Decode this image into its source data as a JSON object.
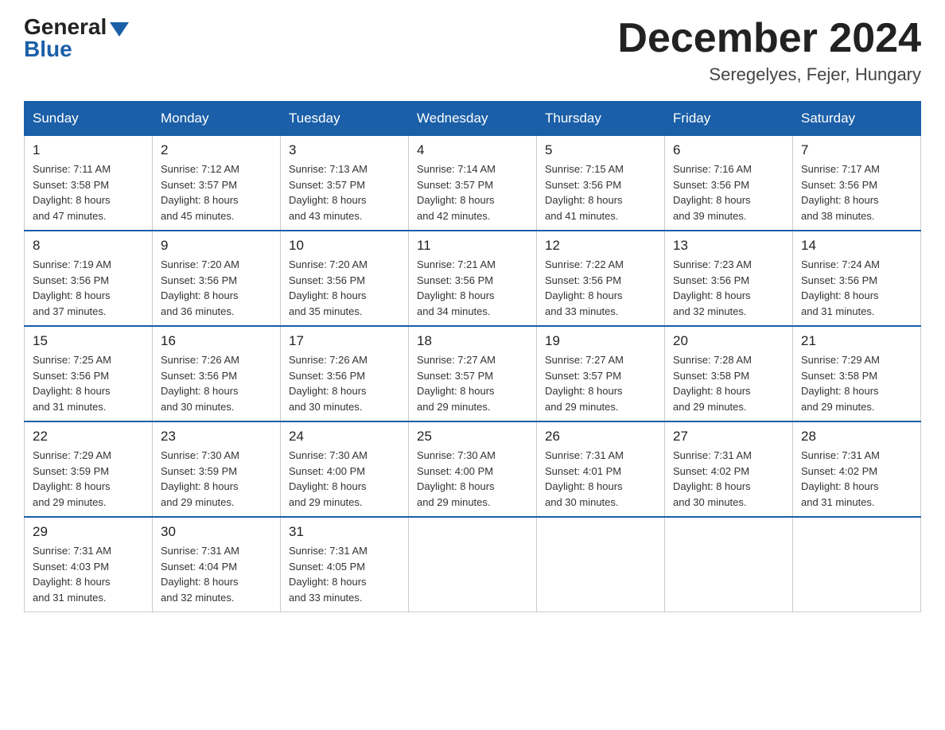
{
  "header": {
    "logo_general": "General",
    "logo_blue": "Blue",
    "month_title": "December 2024",
    "location": "Seregelyes, Fejer, Hungary"
  },
  "days_of_week": [
    "Sunday",
    "Monday",
    "Tuesday",
    "Wednesday",
    "Thursday",
    "Friday",
    "Saturday"
  ],
  "weeks": [
    [
      {
        "day": "1",
        "sunrise": "7:11 AM",
        "sunset": "3:58 PM",
        "daylight": "8 hours and 47 minutes."
      },
      {
        "day": "2",
        "sunrise": "7:12 AM",
        "sunset": "3:57 PM",
        "daylight": "8 hours and 45 minutes."
      },
      {
        "day": "3",
        "sunrise": "7:13 AM",
        "sunset": "3:57 PM",
        "daylight": "8 hours and 43 minutes."
      },
      {
        "day": "4",
        "sunrise": "7:14 AM",
        "sunset": "3:57 PM",
        "daylight": "8 hours and 42 minutes."
      },
      {
        "day": "5",
        "sunrise": "7:15 AM",
        "sunset": "3:56 PM",
        "daylight": "8 hours and 41 minutes."
      },
      {
        "day": "6",
        "sunrise": "7:16 AM",
        "sunset": "3:56 PM",
        "daylight": "8 hours and 39 minutes."
      },
      {
        "day": "7",
        "sunrise": "7:17 AM",
        "sunset": "3:56 PM",
        "daylight": "8 hours and 38 minutes."
      }
    ],
    [
      {
        "day": "8",
        "sunrise": "7:19 AM",
        "sunset": "3:56 PM",
        "daylight": "8 hours and 37 minutes."
      },
      {
        "day": "9",
        "sunrise": "7:20 AM",
        "sunset": "3:56 PM",
        "daylight": "8 hours and 36 minutes."
      },
      {
        "day": "10",
        "sunrise": "7:20 AM",
        "sunset": "3:56 PM",
        "daylight": "8 hours and 35 minutes."
      },
      {
        "day": "11",
        "sunrise": "7:21 AM",
        "sunset": "3:56 PM",
        "daylight": "8 hours and 34 minutes."
      },
      {
        "day": "12",
        "sunrise": "7:22 AM",
        "sunset": "3:56 PM",
        "daylight": "8 hours and 33 minutes."
      },
      {
        "day": "13",
        "sunrise": "7:23 AM",
        "sunset": "3:56 PM",
        "daylight": "8 hours and 32 minutes."
      },
      {
        "day": "14",
        "sunrise": "7:24 AM",
        "sunset": "3:56 PM",
        "daylight": "8 hours and 31 minutes."
      }
    ],
    [
      {
        "day": "15",
        "sunrise": "7:25 AM",
        "sunset": "3:56 PM",
        "daylight": "8 hours and 31 minutes."
      },
      {
        "day": "16",
        "sunrise": "7:26 AM",
        "sunset": "3:56 PM",
        "daylight": "8 hours and 30 minutes."
      },
      {
        "day": "17",
        "sunrise": "7:26 AM",
        "sunset": "3:56 PM",
        "daylight": "8 hours and 30 minutes."
      },
      {
        "day": "18",
        "sunrise": "7:27 AM",
        "sunset": "3:57 PM",
        "daylight": "8 hours and 29 minutes."
      },
      {
        "day": "19",
        "sunrise": "7:27 AM",
        "sunset": "3:57 PM",
        "daylight": "8 hours and 29 minutes."
      },
      {
        "day": "20",
        "sunrise": "7:28 AM",
        "sunset": "3:58 PM",
        "daylight": "8 hours and 29 minutes."
      },
      {
        "day": "21",
        "sunrise": "7:29 AM",
        "sunset": "3:58 PM",
        "daylight": "8 hours and 29 minutes."
      }
    ],
    [
      {
        "day": "22",
        "sunrise": "7:29 AM",
        "sunset": "3:59 PM",
        "daylight": "8 hours and 29 minutes."
      },
      {
        "day": "23",
        "sunrise": "7:30 AM",
        "sunset": "3:59 PM",
        "daylight": "8 hours and 29 minutes."
      },
      {
        "day": "24",
        "sunrise": "7:30 AM",
        "sunset": "4:00 PM",
        "daylight": "8 hours and 29 minutes."
      },
      {
        "day": "25",
        "sunrise": "7:30 AM",
        "sunset": "4:00 PM",
        "daylight": "8 hours and 29 minutes."
      },
      {
        "day": "26",
        "sunrise": "7:31 AM",
        "sunset": "4:01 PM",
        "daylight": "8 hours and 30 minutes."
      },
      {
        "day": "27",
        "sunrise": "7:31 AM",
        "sunset": "4:02 PM",
        "daylight": "8 hours and 30 minutes."
      },
      {
        "day": "28",
        "sunrise": "7:31 AM",
        "sunset": "4:02 PM",
        "daylight": "8 hours and 31 minutes."
      }
    ],
    [
      {
        "day": "29",
        "sunrise": "7:31 AM",
        "sunset": "4:03 PM",
        "daylight": "8 hours and 31 minutes."
      },
      {
        "day": "30",
        "sunrise": "7:31 AM",
        "sunset": "4:04 PM",
        "daylight": "8 hours and 32 minutes."
      },
      {
        "day": "31",
        "sunrise": "7:31 AM",
        "sunset": "4:05 PM",
        "daylight": "8 hours and 33 minutes."
      },
      null,
      null,
      null,
      null
    ]
  ],
  "labels": {
    "sunrise": "Sunrise:",
    "sunset": "Sunset:",
    "daylight": "Daylight:"
  }
}
